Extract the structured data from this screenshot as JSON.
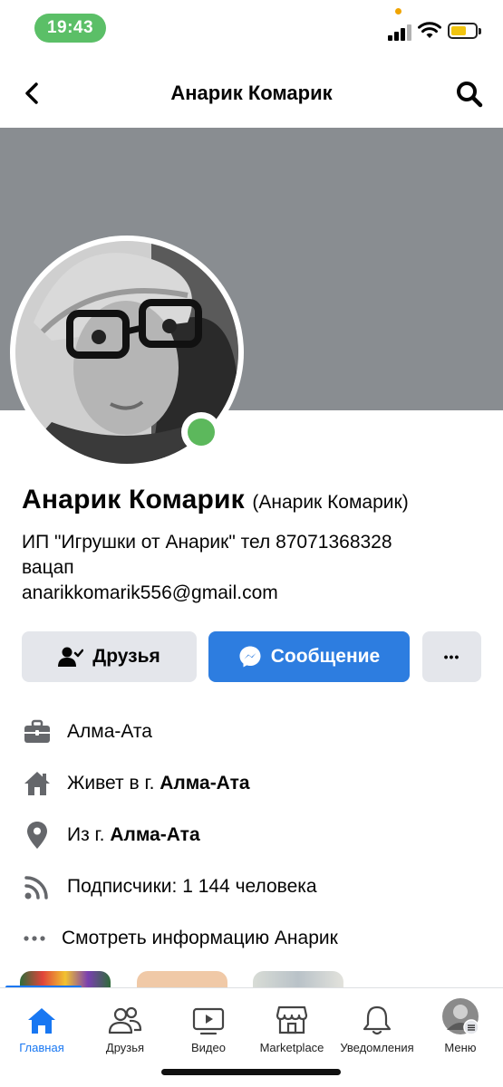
{
  "status_bar": {
    "time": "19:43"
  },
  "header": {
    "title": "Анарик Комарик"
  },
  "profile": {
    "name": "Анарик Комарик",
    "alt_name": "(Анарик Комарик)",
    "bio_line1": "ИП \"Игрушки от Анарик\" тел 87071368328",
    "bio_line2": "вацап",
    "bio_line3": "anarikkomarik556@gmail.com",
    "online": true
  },
  "actions": {
    "friends_label": "Друзья",
    "message_label": "Сообщение",
    "more_label": "•••"
  },
  "details": {
    "work": "Алма-Ата",
    "lives_prefix": "Живет в г.",
    "lives_city": "Алма-Ата",
    "from_prefix": "Из г.",
    "from_city": "Алма-Ата",
    "followers": "Подписчики: 1 144 человека",
    "more_info": "Смотреть информацию Анарик"
  },
  "tabs": [
    {
      "label": "Главная",
      "icon": "home-icon",
      "active": true
    },
    {
      "label": "Друзья",
      "icon": "friends-icon",
      "active": false
    },
    {
      "label": "Видео",
      "icon": "video-icon",
      "active": false
    },
    {
      "label": "Marketplace",
      "icon": "marketplace-icon",
      "active": false
    },
    {
      "label": "Уведомления",
      "icon": "bell-icon",
      "active": false
    },
    {
      "label": "Меню",
      "icon": "menu-avatar-icon",
      "active": false
    }
  ],
  "colors": {
    "accent": "#1877f2",
    "message_button": "#2d7de0",
    "cover": "#898d91",
    "online": "#5cb85c",
    "time_pill": "#5bbf67"
  }
}
